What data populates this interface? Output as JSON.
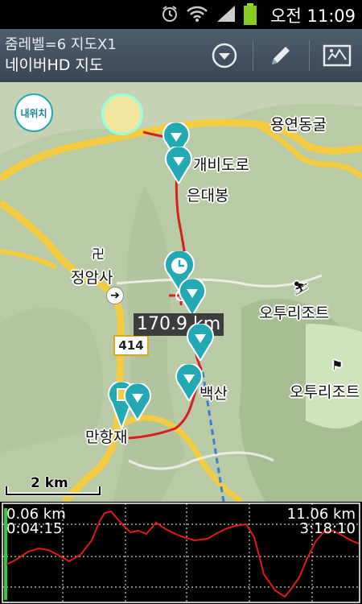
{
  "status_bar": {
    "time": "오전 11:09"
  },
  "header": {
    "zoom_info": "줌레벨=6 지도X1",
    "map_name": "네이버HD 지도"
  },
  "map": {
    "my_location_button": "내위치",
    "labels": {
      "gaebi_road": "개비도로",
      "eundaebong": "은대봉",
      "yongyeon_cave": "용연동굴",
      "jeongamsa": "정암사",
      "road_number": "414",
      "ototo_resort_1": "오투리조트",
      "ototo_resort_2": "오투리조트",
      "baeksan": "백산",
      "manhangjae": "만항재"
    },
    "distance_label": "170.9 km",
    "scale_label": "2 km"
  },
  "profile": {
    "start_distance": "0.06 km",
    "start_time": "0:04:15",
    "end_distance": "11.06 km",
    "end_time": "3:18:10"
  },
  "colors": {
    "route": "#d81e1e",
    "marker": "#22a9b3",
    "road": "#f4cc41",
    "header": "#46525f"
  }
}
